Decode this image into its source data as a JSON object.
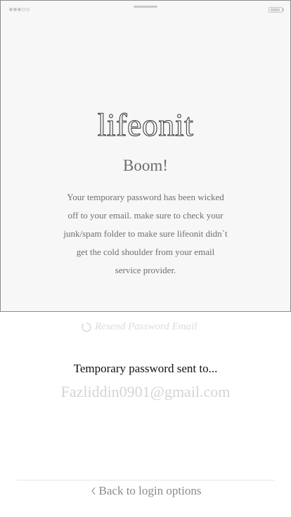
{
  "status_bar": {
    "signal_bars_filled": 3,
    "signal_bars_total": 5
  },
  "logo": "lifeonit",
  "title": "Boom!",
  "message": "Your temporary password has been wicked off to your email. make sure to check your junk/spam folder to make sure lifeonit didn`t get the cold shoulder from your email service provider.",
  "resend_label": "Resend Password Email",
  "sent_label": "Temporary password sent to...",
  "email": "Fazliddin0901@gmail.com",
  "back_label": "Back to login options",
  "icons": {
    "resend": "refresh-icon",
    "back": "chevron-left-icon"
  }
}
